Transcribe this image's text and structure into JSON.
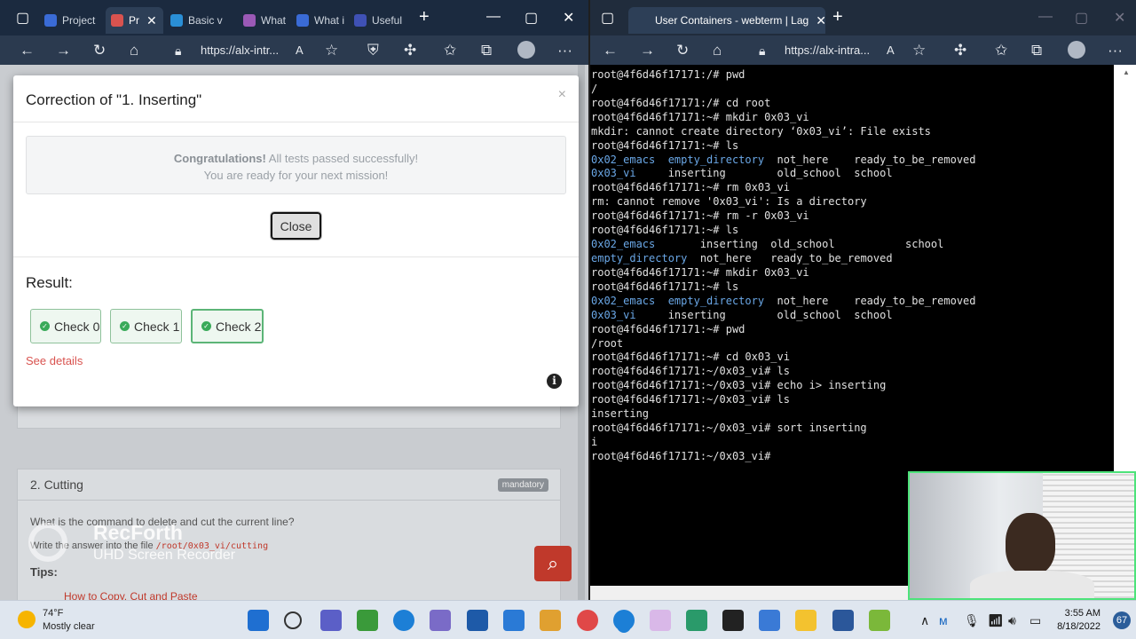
{
  "left_window": {
    "tabs": [
      {
        "label": "Project",
        "color": "#3a6bd6"
      },
      {
        "label": "Pr",
        "color": "#d9534f"
      },
      {
        "label": "Basic v",
        "color": "#2a8fd6"
      },
      {
        "label": "What i",
        "color": "#9b59b6"
      },
      {
        "label": "What i",
        "color": "#3a6bd6"
      },
      {
        "label": "Useful",
        "color": "#3f51b5"
      }
    ],
    "url": "https://alx-intr..."
  },
  "right_window": {
    "tab_title": "User Containers - webterm | Lag",
    "url": "https://alx-intra..."
  },
  "modal": {
    "title": "Correction of \"1. Inserting\"",
    "close_x": "×",
    "congrats_bold": "Congratulations!",
    "congrats_rest": " All tests passed successfully!",
    "congrats_line2": "You are ready for your next mission!",
    "close_button": "Close",
    "result_label": "Result:",
    "checks": [
      "Check 0",
      "Check 1",
      "Check 2"
    ],
    "see_details": "See details",
    "info_icon": "i"
  },
  "background_page": {
    "task_title": "2. Cutting",
    "badge": "mandatory",
    "question": "What is the command to delete and cut the current line?",
    "write_prefix": "Write the answer into the file ",
    "file_path": "/root/0x03_vi/cutting",
    "tips_label": "Tips:",
    "tip_link": "How to Copy, Cut and Paste"
  },
  "terminal": {
    "lines": [
      [
        {
          "t": "root@4f6d46f17171:/# pwd"
        }
      ],
      [
        {
          "t": "/"
        }
      ],
      [
        {
          "t": "root@4f6d46f17171:/# cd root"
        }
      ],
      [
        {
          "t": "root@4f6d46f17171:~# mkdir 0x03_vi"
        }
      ],
      [
        {
          "t": "mkdir: cannot create directory ‘0x03_vi’: File exists"
        }
      ],
      [
        {
          "t": "root@4f6d46f17171:~# ls"
        }
      ],
      [
        {
          "t": "0x02_emacs",
          "c": "blue"
        },
        {
          "t": "  "
        },
        {
          "t": "empty_directory",
          "c": "blue"
        },
        {
          "t": "  not_here    ready_to_be_removed"
        }
      ],
      [
        {
          "t": "0x03_vi",
          "c": "blue"
        },
        {
          "t": "     inserting        old_school  school"
        }
      ],
      [
        {
          "t": "root@4f6d46f17171:~# rm 0x03_vi"
        }
      ],
      [
        {
          "t": "rm: cannot remove '0x03_vi': Is a directory"
        }
      ],
      [
        {
          "t": "root@4f6d46f17171:~# rm -r 0x03_vi"
        }
      ],
      [
        {
          "t": "root@4f6d46f17171:~# ls"
        }
      ],
      [
        {
          "t": "0x02_emacs",
          "c": "blue"
        },
        {
          "t": "       inserting  old_school           school"
        }
      ],
      [
        {
          "t": "empty_directory",
          "c": "blue"
        },
        {
          "t": "  not_here   ready_to_be_removed"
        }
      ],
      [
        {
          "t": "root@4f6d46f17171:~# mkdir 0x03_vi"
        }
      ],
      [
        {
          "t": "root@4f6d46f17171:~# ls"
        }
      ],
      [
        {
          "t": "0x02_emacs",
          "c": "blue"
        },
        {
          "t": "  "
        },
        {
          "t": "empty_directory",
          "c": "blue"
        },
        {
          "t": "  not_here    ready_to_be_removed"
        }
      ],
      [
        {
          "t": "0x03_vi",
          "c": "blue"
        },
        {
          "t": "     inserting        old_school  school"
        }
      ],
      [
        {
          "t": "root@4f6d46f17171:~# pwd"
        }
      ],
      [
        {
          "t": "/root"
        }
      ],
      [
        {
          "t": "root@4f6d46f17171:~# cd 0x03_vi"
        }
      ],
      [
        {
          "t": "root@4f6d46f17171:~/0x03_vi# ls"
        }
      ],
      [
        {
          "t": "root@4f6d46f17171:~/0x03_vi# echo i> inserting"
        }
      ],
      [
        {
          "t": "root@4f6d46f17171:~/0x03_vi# ls"
        }
      ],
      [
        {
          "t": "inserting"
        }
      ],
      [
        {
          "t": "root@4f6d46f17171:~/0x03_vi# sort inserting"
        }
      ],
      [
        {
          "t": "i"
        }
      ],
      [
        {
          "t": "root@4f6d46f17171:~/0x03_vi# "
        }
      ]
    ]
  },
  "watermark": {
    "line1": "RecForth",
    "line2": "UHD Screen Recorder"
  },
  "taskbar": {
    "temperature": "74°F",
    "weather": "Mostly clear",
    "time": "3:55 AM",
    "date": "8/18/2022",
    "notifications": "67"
  },
  "colors": {
    "terminal_blue": "#6aa7e6",
    "accent_green": "#3aaa5a",
    "link_red": "#d9534f"
  }
}
